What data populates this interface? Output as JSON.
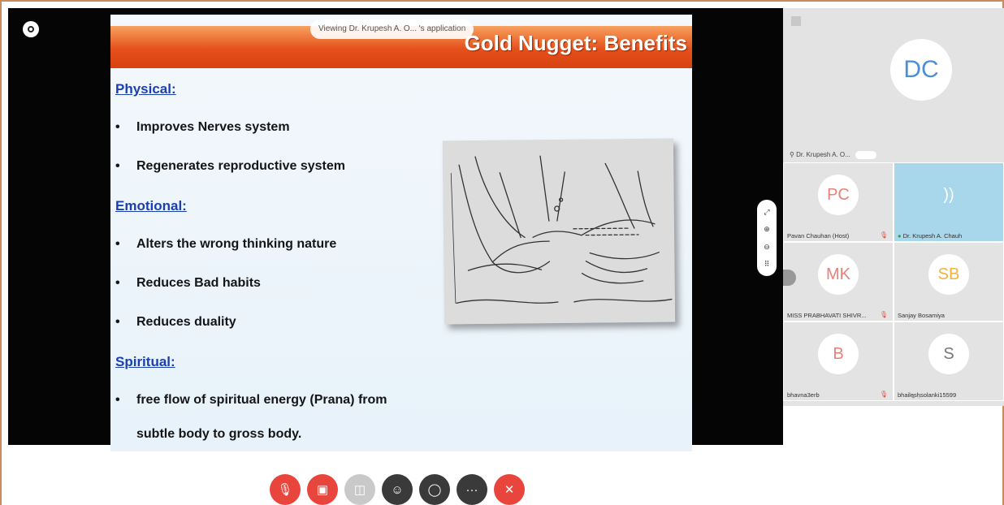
{
  "share": {
    "viewing_banner": "Viewing Dr. Krupesh A. O... 's application"
  },
  "slide": {
    "title": "Gold Nugget: Benefits",
    "sections": {
      "physical": {
        "heading": "Physical:",
        "items": [
          "Improves Nerves system",
          "Regenerates reproductive system"
        ]
      },
      "emotional": {
        "heading": "Emotional:",
        "items": [
          "Alters the wrong thinking nature",
          "Reduces Bad habits",
          "Reduces duality"
        ]
      },
      "spiritual": {
        "heading": "Spiritual:",
        "items": [
          "free flow of spiritual energy (Prana) from",
          "subtle body to gross body."
        ]
      }
    }
  },
  "panel": {
    "speaker": {
      "initials": "DC",
      "name": "Dr. Krupesh A. O..."
    },
    "tiles": [
      {
        "initials": "PC",
        "name": "Pavan Chauhan (Host)",
        "color": "#e9807a"
      },
      {
        "initials": "))",
        "name": "Dr. Krupesh A. Chauh",
        "color": "#ffffff"
      },
      {
        "initials": "MK",
        "name": "MISS PRABHAVATI SHIVR...",
        "color": "#e9807a"
      },
      {
        "initials": "SB",
        "name": "Sanjay Bosamiya",
        "color": "#f2b23c"
      },
      {
        "initials": "B",
        "name": "bhavna3erb",
        "color": "#e9807a"
      },
      {
        "initials": "S",
        "name": "bhaileshsolanki15599",
        "color": "#777777"
      }
    ],
    "page_dots": "● ○"
  },
  "controls": [
    {
      "name": "mute-button",
      "icon": "microphone-slash-icon",
      "glyph": "🎙",
      "color": "#e8453c"
    },
    {
      "name": "stop-video-button",
      "icon": "camera-slash-icon",
      "glyph": "▣",
      "color": "#e8453c"
    },
    {
      "name": "share-button",
      "icon": "share-icon",
      "glyph": "◫",
      "color": "#c9c9c9"
    },
    {
      "name": "participants-button",
      "icon": "user-icon",
      "glyph": "☺",
      "color": "#3a3a3a"
    },
    {
      "name": "chat-button",
      "icon": "chat-bubble-icon",
      "glyph": "◯",
      "color": "#3a3a3a"
    },
    {
      "name": "more-button",
      "icon": "more-icon",
      "glyph": "···",
      "color": "#3a3a3a"
    },
    {
      "name": "leave-button",
      "icon": "close-icon",
      "glyph": "✕",
      "color": "#e8453c"
    }
  ]
}
